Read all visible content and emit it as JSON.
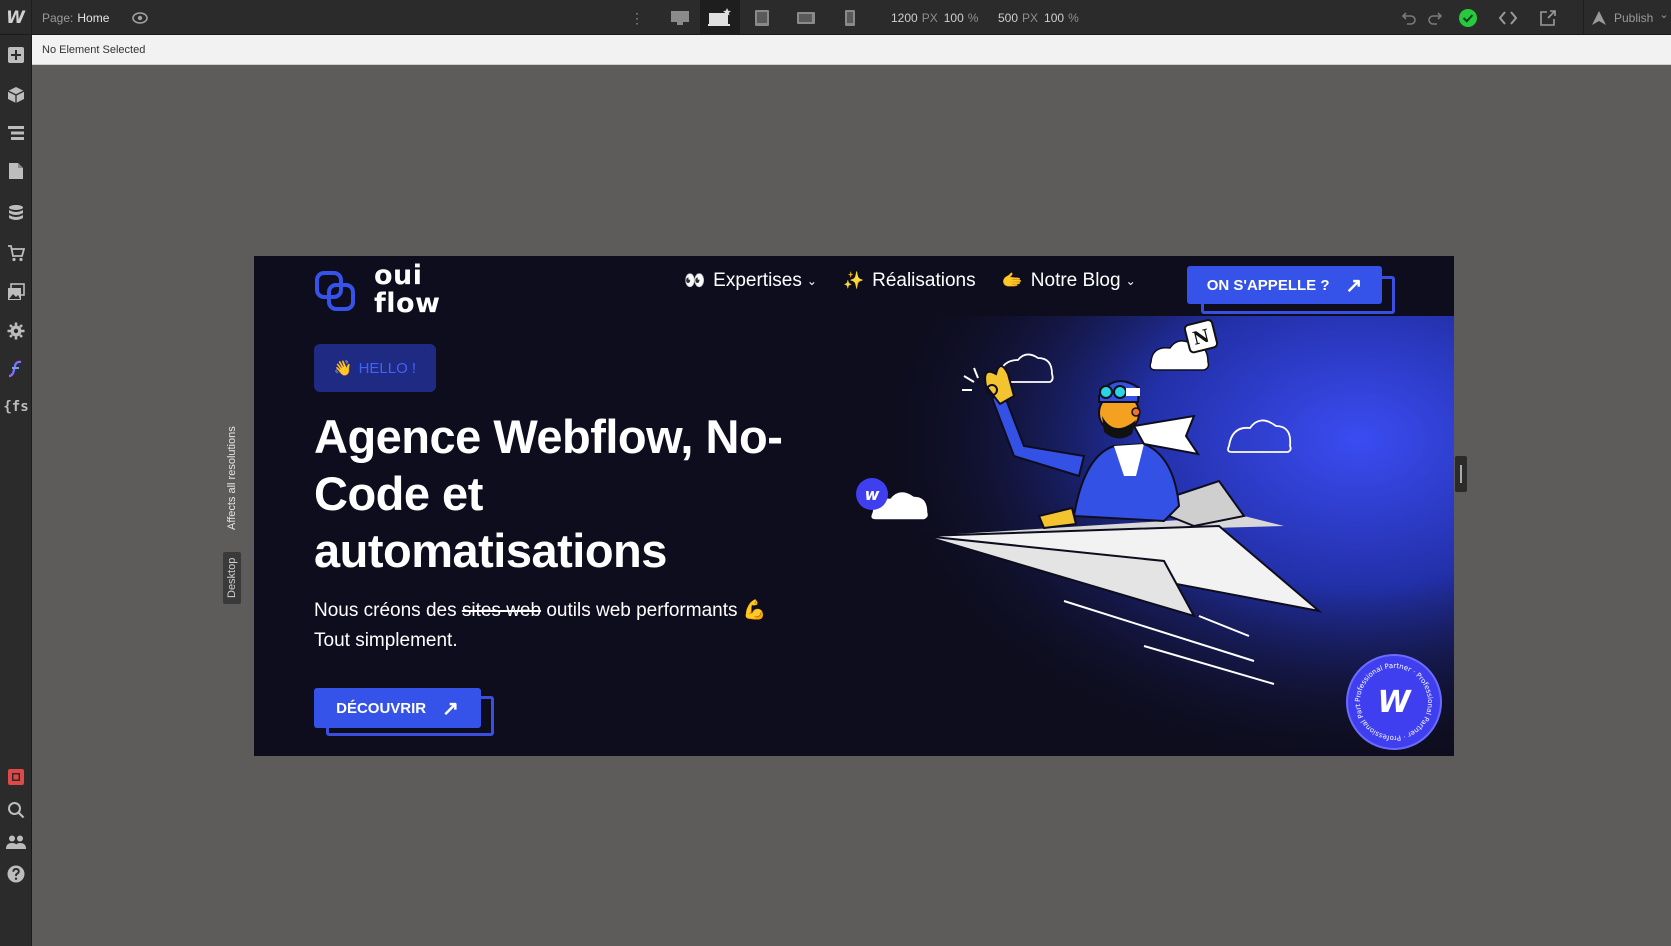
{
  "app": {
    "logo_letter": "W",
    "page_label": "Page:",
    "page_name": "Home",
    "more_icon": "⋮",
    "selection_text": "No Element Selected",
    "publish_label": "Publish",
    "publish_chevron": "⌄"
  },
  "breakpoints": {
    "items": [
      {
        "name": "desktop-icon",
        "active": false
      },
      {
        "name": "desktop-base-star-icon",
        "active": true
      },
      {
        "name": "tablet-icon",
        "active": false
      },
      {
        "name": "mobile-landscape-icon",
        "active": false
      },
      {
        "name": "mobile-portrait-icon",
        "active": false
      }
    ],
    "width_value": "1200",
    "width_unit": "PX",
    "width_zoom": "100",
    "width_zoom_unit": "%",
    "height_value": "500",
    "height_unit": "PX",
    "height_zoom": "100",
    "height_zoom_unit": "%"
  },
  "toolbar_right": {
    "undo_icon": "undo-icon",
    "redo_icon": "redo-icon",
    "status_icon": "check-circle-icon",
    "status_color": "#27c93f",
    "code_icon": "code-icon",
    "share_icon": "export-icon",
    "publish_icon": "rocket-icon"
  },
  "sidebar": {
    "top": [
      "add-icon",
      "box-icon",
      "navigator-icon",
      "pages-icon",
      "cms-icon",
      "ecommerce-icon",
      "assets-icon",
      "settings-icon",
      "finsweet-icon",
      "fs-icon"
    ],
    "fs_label": "{fs",
    "bottom": [
      "record-icon",
      "search-icon",
      "users-icon",
      "help-icon"
    ]
  },
  "vertical_tags": {
    "desktop": "Desktop",
    "affects": "Affects all resolutions"
  },
  "site": {
    "logo_line1": "oui",
    "logo_line2": "flow",
    "nav": [
      {
        "emoji": "👀",
        "label": "Expertises",
        "chevron": "⌄"
      },
      {
        "emoji": "✨",
        "label": "Réalisations",
        "chevron": ""
      },
      {
        "emoji": "🫱",
        "label": "Notre Blog",
        "chevron": "⌄"
      }
    ],
    "cta_label": "ON S'APPELLE ?",
    "arrow": "↗",
    "hello_emoji": "👋",
    "hello_label": "HELLO !",
    "hero_title": "Agence Webflow, No-Code et automatisations",
    "sub_before": "Nous créons des ",
    "sub_strike": "sites web",
    "sub_after": " outils web performants ",
    "sub_emoji": "💪",
    "sub_line2": "Tout simplement.",
    "button_label": "DÉCOUVRIR",
    "partner_letter": "W",
    "partner_ring_text": "Professional Partner · Professional Partner · Professional Partner ·",
    "notion_letter": "N",
    "webflow_badge_letter": "w",
    "colors": {
      "accent": "#3553e8",
      "bg": "#0e0d1e",
      "yellow": "#f4c430"
    }
  }
}
